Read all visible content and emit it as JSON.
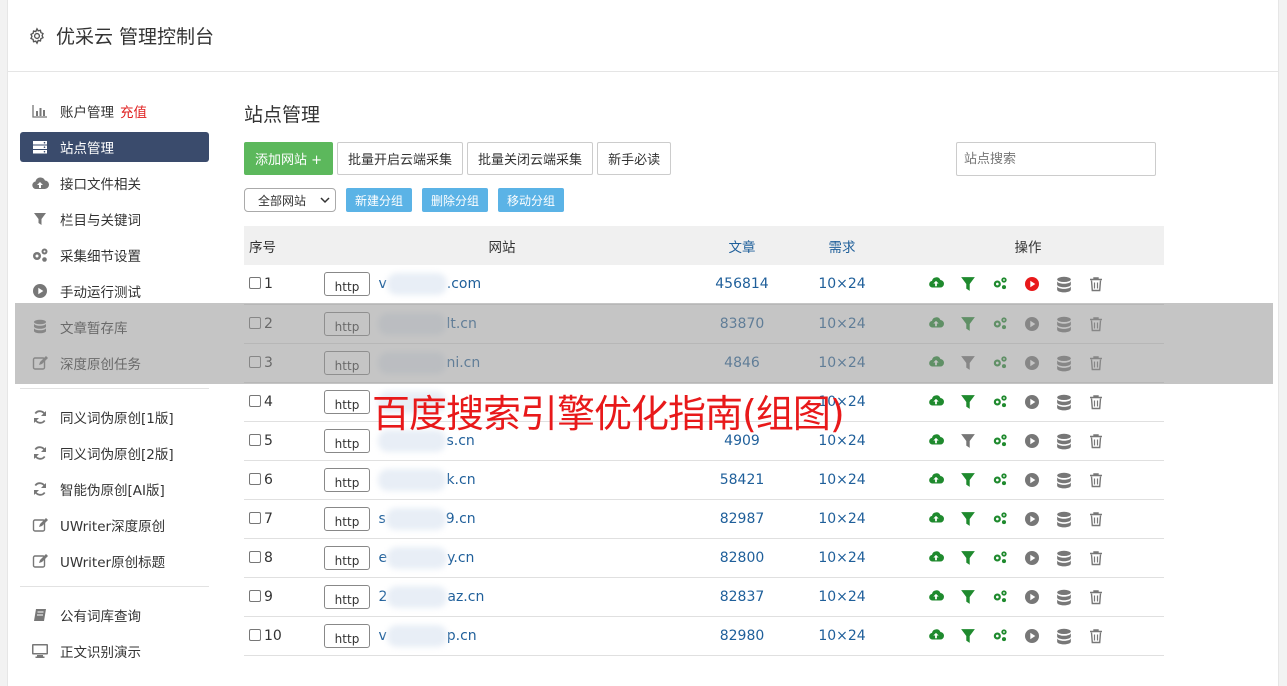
{
  "header": {
    "title": "优采云 管理控制台"
  },
  "sidebar": {
    "items": [
      {
        "label": "账户管理",
        "extra": "充值",
        "icon": "bar-chart-icon",
        "active": false
      },
      {
        "label": "站点管理",
        "icon": "server-icon",
        "active": true
      },
      {
        "label": "接口文件相关",
        "icon": "cloud-upload-icon",
        "active": false
      },
      {
        "label": "栏目与关键词",
        "icon": "filter-icon",
        "active": false
      },
      {
        "label": "采集细节设置",
        "icon": "gears-icon",
        "active": false
      },
      {
        "label": "手动运行测试",
        "icon": "play-icon",
        "active": false
      },
      {
        "label": "文章暂存库",
        "icon": "database-icon",
        "active": false
      },
      {
        "label": "深度原创任务",
        "icon": "edit-icon",
        "active": false
      }
    ],
    "items2": [
      {
        "label": "同义词伪原创[1版]",
        "icon": "refresh-icon"
      },
      {
        "label": "同义词伪原创[2版]",
        "icon": "refresh-icon"
      },
      {
        "label": "智能伪原创[AI版]",
        "icon": "refresh-icon"
      },
      {
        "label": "UWriter深度原创",
        "icon": "edit-icon"
      },
      {
        "label": "UWriter原创标题",
        "icon": "edit-icon"
      }
    ],
    "items3": [
      {
        "label": "公有词库查询",
        "icon": "book-icon"
      },
      {
        "label": "正文识别演示",
        "icon": "monitor-icon"
      }
    ]
  },
  "main": {
    "title": "站点管理",
    "toolbar": {
      "add": "添加网站 +",
      "batch_on": "批量开启云端采集",
      "batch_off": "批量关闭云端采集",
      "guide": "新手必读"
    },
    "search_placeholder": "站点搜索",
    "group_select": "全部网站",
    "group_buttons": {
      "new": "新建分组",
      "delete": "删除分组",
      "move": "移动分组"
    },
    "columns": {
      "no": "序号",
      "site": "网站",
      "articles": "文章",
      "demand": "需求",
      "ops": "操作"
    },
    "rows": [
      {
        "no": "1",
        "prefix": "http",
        "domain_start": "v",
        "domain": ".com",
        "articles": "456814",
        "demand": "10×24",
        "filter_active": true,
        "run_active": true
      },
      {
        "no": "2",
        "prefix": "http",
        "domain_start": "",
        "domain": "lt.cn",
        "articles": "83870",
        "demand": "10×24",
        "filter_active": true,
        "run_active": false
      },
      {
        "no": "3",
        "prefix": "http",
        "domain_start": "",
        "domain": "ni.cn",
        "articles": "4846",
        "demand": "10×24",
        "filter_active": false,
        "run_active": false
      },
      {
        "no": "4",
        "prefix": "http",
        "domain_start": "",
        "domain": "",
        "articles": "",
        "demand": "10×24",
        "filter_active": true,
        "run_active": false
      },
      {
        "no": "5",
        "prefix": "http",
        "domain_start": "",
        "domain": "s.cn",
        "articles": "4909",
        "demand": "10×24",
        "filter_active": false,
        "run_active": false
      },
      {
        "no": "6",
        "prefix": "http",
        "domain_start": "",
        "domain": "k.cn",
        "articles": "58421",
        "demand": "10×24",
        "filter_active": true,
        "run_active": false
      },
      {
        "no": "7",
        "prefix": "http",
        "domain_start": "s",
        "domain": "9.cn",
        "articles": "82987",
        "demand": "10×24",
        "filter_active": true,
        "run_active": false
      },
      {
        "no": "8",
        "prefix": "http",
        "domain_start": "e",
        "domain": "y.cn",
        "articles": "82800",
        "demand": "10×24",
        "filter_active": true,
        "run_active": false
      },
      {
        "no": "9",
        "prefix": "http",
        "domain_start": "2",
        "domain": "az.cn",
        "articles": "82837",
        "demand": "10×24",
        "filter_active": true,
        "run_active": false
      },
      {
        "no": "10",
        "prefix": "http",
        "domain_start": "v",
        "domain": "p.cn",
        "articles": "82980",
        "demand": "10×24",
        "filter_active": true,
        "run_active": false
      }
    ]
  },
  "watermark": "百度搜索引擎优化指南(组图)",
  "colors": {
    "accent": "#3a4b6c",
    "green": "#5cb85c",
    "blue_btn": "#5bb3e6",
    "link": "#1f5f9a",
    "red": "#e02020",
    "op_green": "#1f8a2e"
  }
}
